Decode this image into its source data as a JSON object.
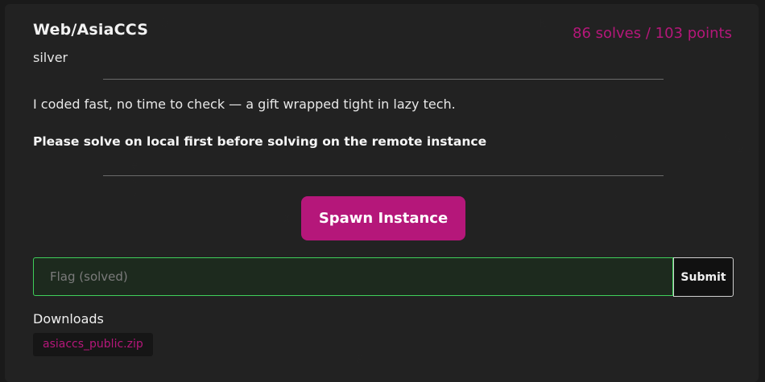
{
  "challenge": {
    "title": "Web/AsiaCCS",
    "difficulty": "silver",
    "stats": "86 solves / 103 points",
    "description": "I coded fast, no time to check — a gift wrapped tight in lazy tech.",
    "note": "Please solve on local first before solving on the remote instance"
  },
  "instance": {
    "spawn_label": "Spawn Instance"
  },
  "flag_form": {
    "placeholder": "Flag (solved)",
    "value": "",
    "submit_label": "Submit"
  },
  "downloads": {
    "label": "Downloads",
    "files": [
      {
        "name": "asiaccs_public.zip"
      }
    ]
  },
  "colors": {
    "accent": "#b5177a",
    "input_border": "#3fcf5a",
    "card_bg": "#222222",
    "page_bg": "#1a1a1a"
  }
}
